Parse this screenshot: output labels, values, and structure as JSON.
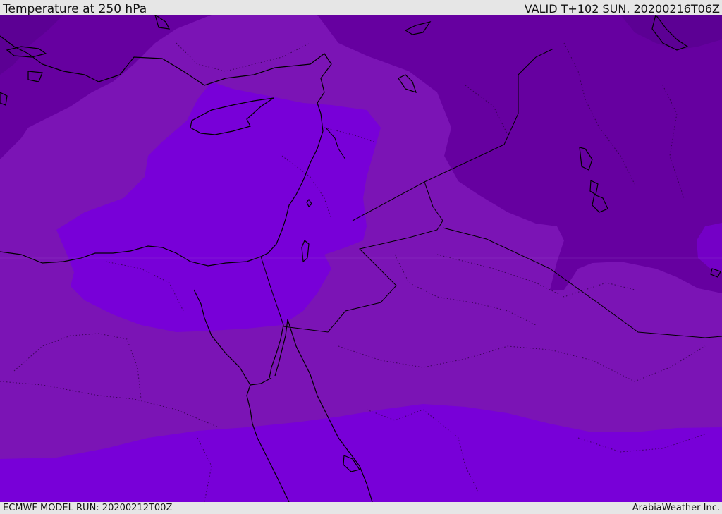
{
  "header": {
    "title": "Temperature at 250 hPa",
    "valid_time": "VALID T+102 SUN. 20200216T06Z"
  },
  "footer": {
    "model_run": "ECMWF MODEL RUN: 20200212T00Z",
    "credit": "ArabiaWeather Inc."
  },
  "map": {
    "colors": {
      "coldest": "#5c0094",
      "cold": "#6a00a4",
      "mid": "#7c14b6",
      "warm": "#7900d8",
      "coast_line": "#000000"
    }
  }
}
